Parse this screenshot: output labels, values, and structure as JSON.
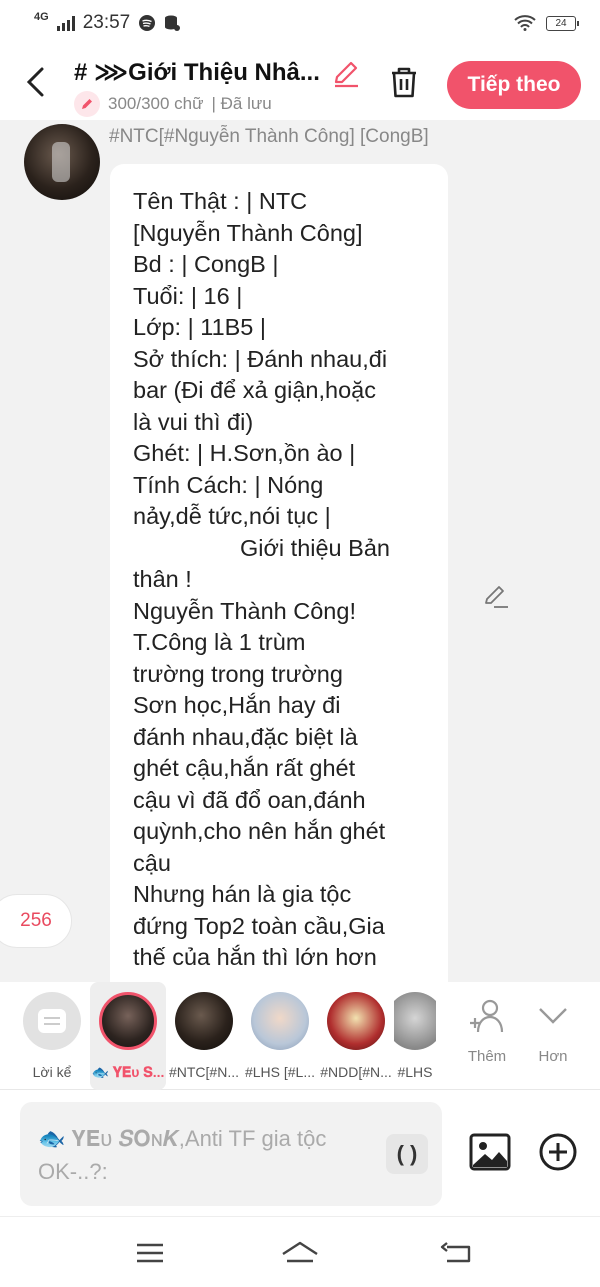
{
  "status_bar": {
    "network": "4G",
    "time": "23:57",
    "battery": "24"
  },
  "header": {
    "title": "# ⋙Giới Thiệu Nhâ...",
    "word_count": "300/300 chữ",
    "save_status": "| Đã lưu",
    "next_label": "Tiếp theo",
    "accent_color": "#f1536b"
  },
  "message": {
    "sender": "#NTC[#Nguyễn Thành Công] [CongB]",
    "lines": [
      "Tên Thật : | NTC",
      "[Nguyễn Thành Công]",
      "Bd : | CongB |",
      "Tuổi: | 16 |",
      "Lớp: | 11B5 |",
      "Sở thích: | Đánh nhau,đi",
      "bar (Đi để xả giận,hoặc",
      "là vui thì đi)",
      "Ghét: | H.Sơn,ồn ào |",
      "Tính Cách: | Nóng",
      "nảy,dễ tức,nói tục |",
      "Giới thiệu Bản",
      "thân !",
      "Nguyễn Thành Công!",
      "T.Công là 1 trùm",
      "trường trong trường",
      "Sơn học,Hắn hay đi",
      "đánh nhau,đặc biệt là",
      "ghét cậu,hắn rất ghét",
      "cậu vì đã đổ oan,đánh",
      "quỳnh,cho nên hắn ghét",
      "cậu",
      "Nhưng hán là gia tộc",
      "đứng Top2 toàn cầu,Gia",
      "thế của hắn thì lớn hơn"
    ]
  },
  "counter": "256",
  "characters": [
    {
      "label": "Lời kể",
      "icon": "narrator-icon"
    },
    {
      "label": "🐟 𝐘𝐄ᴜ 𝐒...",
      "active": true
    },
    {
      "label": "#NTC[#N..."
    },
    {
      "label": "#LHS [#L..."
    },
    {
      "label": "#NDD[#N..."
    },
    {
      "label": "#LHS"
    }
  ],
  "actions": {
    "more_label": "Thêm",
    "collapse_label": "Hơn"
  },
  "input": {
    "placeholder": "🐟 𝐘𝐄ᴜ 𝑺𝐎ɴ𝑲,Anti TF gia tộc OK-..?:",
    "paren_label": "( )"
  }
}
